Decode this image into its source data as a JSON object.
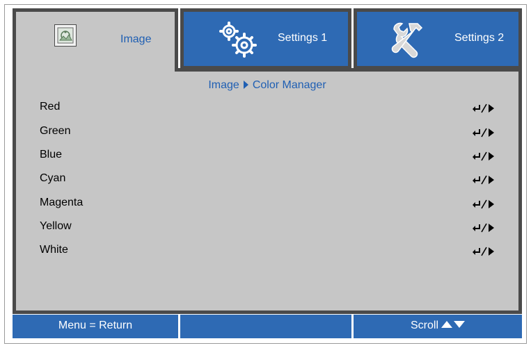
{
  "tabs": [
    {
      "label": "Image",
      "icon": "image-icon",
      "active": true
    },
    {
      "label": "Settings 1",
      "icon": "gears-icon",
      "active": false
    },
    {
      "label": "Settings 2",
      "icon": "tools-icon",
      "active": false
    }
  ],
  "breadcrumb": {
    "parent": "Image",
    "current": "Color Manager"
  },
  "menu_items": [
    {
      "label": "Red",
      "action": "enter-or-right"
    },
    {
      "label": "Green",
      "action": "enter-or-right"
    },
    {
      "label": "Blue",
      "action": "enter-or-right"
    },
    {
      "label": "Cyan",
      "action": "enter-or-right"
    },
    {
      "label": "Magenta",
      "action": "enter-or-right"
    },
    {
      "label": "Yellow",
      "action": "enter-or-right"
    },
    {
      "label": "White",
      "action": "enter-or-right"
    }
  ],
  "footer": {
    "left": "Menu = Return",
    "middle": "",
    "right": "Scroll"
  },
  "colors": {
    "tab_blue": "#2e6ab4",
    "panel_gray": "#c6c6c6",
    "border_dark": "#4a4a4a",
    "accent_text": "#1f5fb3"
  }
}
